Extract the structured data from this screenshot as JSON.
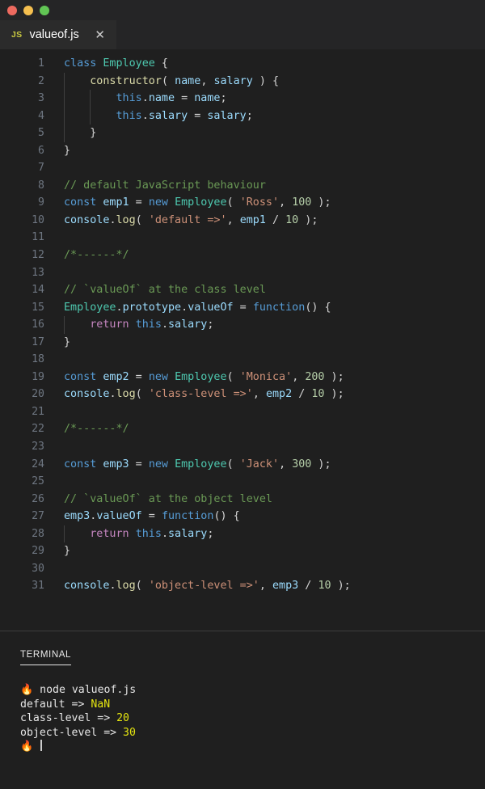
{
  "window": {
    "traffic_lights": [
      {
        "name": "close",
        "color": "#ed6a5f"
      },
      {
        "name": "minimize",
        "color": "#f5bf4f"
      },
      {
        "name": "maximize",
        "color": "#61c554"
      }
    ]
  },
  "tab": {
    "file_type_badge": "JS",
    "filename": "valueof.js",
    "close_glyph": "✕"
  },
  "editor": {
    "language": "javascript",
    "total_lines": 31,
    "lines": [
      {
        "n": "1",
        "indent": 0,
        "tokens": [
          {
            "t": "class",
            "c": "kw"
          },
          {
            "t": " ",
            "c": "pun"
          },
          {
            "t": "Employee",
            "c": "type"
          },
          {
            "t": " {",
            "c": "pun"
          }
        ]
      },
      {
        "n": "2",
        "indent": 1,
        "tokens": [
          {
            "t": "    ",
            "c": "pun"
          },
          {
            "t": "constructor",
            "c": "fn"
          },
          {
            "t": "( ",
            "c": "pun"
          },
          {
            "t": "name",
            "c": "var"
          },
          {
            "t": ", ",
            "c": "pun"
          },
          {
            "t": "salary",
            "c": "var"
          },
          {
            "t": " ) {",
            "c": "pun"
          }
        ]
      },
      {
        "n": "3",
        "indent": 2,
        "tokens": [
          {
            "t": "        ",
            "c": "pun"
          },
          {
            "t": "this",
            "c": "kw"
          },
          {
            "t": ".",
            "c": "pun"
          },
          {
            "t": "name",
            "c": "var"
          },
          {
            "t": " = ",
            "c": "pun"
          },
          {
            "t": "name",
            "c": "var"
          },
          {
            "t": ";",
            "c": "pun"
          }
        ]
      },
      {
        "n": "4",
        "indent": 2,
        "tokens": [
          {
            "t": "        ",
            "c": "pun"
          },
          {
            "t": "this",
            "c": "kw"
          },
          {
            "t": ".",
            "c": "pun"
          },
          {
            "t": "salary",
            "c": "var"
          },
          {
            "t": " = ",
            "c": "pun"
          },
          {
            "t": "salary",
            "c": "var"
          },
          {
            "t": ";",
            "c": "pun"
          }
        ]
      },
      {
        "n": "5",
        "indent": 1,
        "tokens": [
          {
            "t": "    }",
            "c": "pun"
          }
        ]
      },
      {
        "n": "6",
        "indent": 0,
        "tokens": [
          {
            "t": "}",
            "c": "pun"
          }
        ]
      },
      {
        "n": "7",
        "indent": 0,
        "tokens": []
      },
      {
        "n": "8",
        "indent": 0,
        "tokens": [
          {
            "t": "// default JavaScript behaviour",
            "c": "cmt"
          }
        ]
      },
      {
        "n": "9",
        "indent": 0,
        "tokens": [
          {
            "t": "const",
            "c": "kw"
          },
          {
            "t": " ",
            "c": "pun"
          },
          {
            "t": "emp1",
            "c": "var"
          },
          {
            "t": " = ",
            "c": "pun"
          },
          {
            "t": "new",
            "c": "kw"
          },
          {
            "t": " ",
            "c": "pun"
          },
          {
            "t": "Employee",
            "c": "type"
          },
          {
            "t": "( ",
            "c": "pun"
          },
          {
            "t": "'Ross'",
            "c": "str"
          },
          {
            "t": ", ",
            "c": "pun"
          },
          {
            "t": "100",
            "c": "num"
          },
          {
            "t": " );",
            "c": "pun"
          }
        ]
      },
      {
        "n": "10",
        "indent": 0,
        "tokens": [
          {
            "t": "console",
            "c": "var"
          },
          {
            "t": ".",
            "c": "pun"
          },
          {
            "t": "log",
            "c": "fn"
          },
          {
            "t": "( ",
            "c": "pun"
          },
          {
            "t": "'default =>'",
            "c": "str"
          },
          {
            "t": ", ",
            "c": "pun"
          },
          {
            "t": "emp1",
            "c": "var"
          },
          {
            "t": " / ",
            "c": "pun"
          },
          {
            "t": "10",
            "c": "num"
          },
          {
            "t": " );",
            "c": "pun"
          }
        ]
      },
      {
        "n": "11",
        "indent": 0,
        "tokens": []
      },
      {
        "n": "12",
        "indent": 0,
        "tokens": [
          {
            "t": "/*------*/",
            "c": "cmt"
          }
        ]
      },
      {
        "n": "13",
        "indent": 0,
        "tokens": []
      },
      {
        "n": "14",
        "indent": 0,
        "tokens": [
          {
            "t": "// `valueOf` at the class level",
            "c": "cmt"
          }
        ]
      },
      {
        "n": "15",
        "indent": 0,
        "tokens": [
          {
            "t": "Employee",
            "c": "type"
          },
          {
            "t": ".",
            "c": "pun"
          },
          {
            "t": "prototype",
            "c": "var"
          },
          {
            "t": ".",
            "c": "pun"
          },
          {
            "t": "valueOf",
            "c": "var"
          },
          {
            "t": " = ",
            "c": "pun"
          },
          {
            "t": "function",
            "c": "kw"
          },
          {
            "t": "() {",
            "c": "pun"
          }
        ]
      },
      {
        "n": "16",
        "indent": 1,
        "tokens": [
          {
            "t": "    ",
            "c": "pun"
          },
          {
            "t": "return",
            "c": "ctrl"
          },
          {
            "t": " ",
            "c": "pun"
          },
          {
            "t": "this",
            "c": "kw"
          },
          {
            "t": ".",
            "c": "pun"
          },
          {
            "t": "salary",
            "c": "var"
          },
          {
            "t": ";",
            "c": "pun"
          }
        ]
      },
      {
        "n": "17",
        "indent": 0,
        "tokens": [
          {
            "t": "}",
            "c": "pun"
          }
        ]
      },
      {
        "n": "18",
        "indent": 0,
        "tokens": []
      },
      {
        "n": "19",
        "indent": 0,
        "tokens": [
          {
            "t": "const",
            "c": "kw"
          },
          {
            "t": " ",
            "c": "pun"
          },
          {
            "t": "emp2",
            "c": "var"
          },
          {
            "t": " = ",
            "c": "pun"
          },
          {
            "t": "new",
            "c": "kw"
          },
          {
            "t": " ",
            "c": "pun"
          },
          {
            "t": "Employee",
            "c": "type"
          },
          {
            "t": "( ",
            "c": "pun"
          },
          {
            "t": "'Monica'",
            "c": "str"
          },
          {
            "t": ", ",
            "c": "pun"
          },
          {
            "t": "200",
            "c": "num"
          },
          {
            "t": " );",
            "c": "pun"
          }
        ]
      },
      {
        "n": "20",
        "indent": 0,
        "tokens": [
          {
            "t": "console",
            "c": "var"
          },
          {
            "t": ".",
            "c": "pun"
          },
          {
            "t": "log",
            "c": "fn"
          },
          {
            "t": "( ",
            "c": "pun"
          },
          {
            "t": "'class-level =>'",
            "c": "str"
          },
          {
            "t": ", ",
            "c": "pun"
          },
          {
            "t": "emp2",
            "c": "var"
          },
          {
            "t": " / ",
            "c": "pun"
          },
          {
            "t": "10",
            "c": "num"
          },
          {
            "t": " );",
            "c": "pun"
          }
        ]
      },
      {
        "n": "21",
        "indent": 0,
        "tokens": []
      },
      {
        "n": "22",
        "indent": 0,
        "tokens": [
          {
            "t": "/*------*/",
            "c": "cmt"
          }
        ]
      },
      {
        "n": "23",
        "indent": 0,
        "tokens": []
      },
      {
        "n": "24",
        "indent": 0,
        "tokens": [
          {
            "t": "const",
            "c": "kw"
          },
          {
            "t": " ",
            "c": "pun"
          },
          {
            "t": "emp3",
            "c": "var"
          },
          {
            "t": " = ",
            "c": "pun"
          },
          {
            "t": "new",
            "c": "kw"
          },
          {
            "t": " ",
            "c": "pun"
          },
          {
            "t": "Employee",
            "c": "type"
          },
          {
            "t": "( ",
            "c": "pun"
          },
          {
            "t": "'Jack'",
            "c": "str"
          },
          {
            "t": ", ",
            "c": "pun"
          },
          {
            "t": "300",
            "c": "num"
          },
          {
            "t": " );",
            "c": "pun"
          }
        ]
      },
      {
        "n": "25",
        "indent": 0,
        "tokens": []
      },
      {
        "n": "26",
        "indent": 0,
        "tokens": [
          {
            "t": "// `valueOf` at the object level",
            "c": "cmt"
          }
        ]
      },
      {
        "n": "27",
        "indent": 0,
        "tokens": [
          {
            "t": "emp3",
            "c": "var"
          },
          {
            "t": ".",
            "c": "pun"
          },
          {
            "t": "valueOf",
            "c": "var"
          },
          {
            "t": " = ",
            "c": "pun"
          },
          {
            "t": "function",
            "c": "kw"
          },
          {
            "t": "() {",
            "c": "pun"
          }
        ]
      },
      {
        "n": "28",
        "indent": 1,
        "tokens": [
          {
            "t": "    ",
            "c": "pun"
          },
          {
            "t": "return",
            "c": "ctrl"
          },
          {
            "t": " ",
            "c": "pun"
          },
          {
            "t": "this",
            "c": "kw"
          },
          {
            "t": ".",
            "c": "pun"
          },
          {
            "t": "salary",
            "c": "var"
          },
          {
            "t": ";",
            "c": "pun"
          }
        ]
      },
      {
        "n": "29",
        "indent": 0,
        "tokens": [
          {
            "t": "}",
            "c": "pun"
          }
        ]
      },
      {
        "n": "30",
        "indent": 0,
        "tokens": []
      },
      {
        "n": "31",
        "indent": 0,
        "tokens": [
          {
            "t": "console",
            "c": "var"
          },
          {
            "t": ".",
            "c": "pun"
          },
          {
            "t": "log",
            "c": "fn"
          },
          {
            "t": "( ",
            "c": "pun"
          },
          {
            "t": "'object-level =>'",
            "c": "str"
          },
          {
            "t": ", ",
            "c": "pun"
          },
          {
            "t": "emp3",
            "c": "var"
          },
          {
            "t": " / ",
            "c": "pun"
          },
          {
            "t": "10",
            "c": "num"
          },
          {
            "t": " );",
            "c": "pun"
          }
        ]
      }
    ]
  },
  "panel": {
    "active_tab": "TERMINAL",
    "terminal": {
      "lines": [
        {
          "parts": [
            {
              "t": "🔥",
              "c": "flame"
            },
            {
              "t": " node valueof.js",
              "c": "plain"
            }
          ]
        },
        {
          "parts": [
            {
              "t": "default => ",
              "c": "plain"
            },
            {
              "t": "NaN",
              "c": "tnum"
            }
          ]
        },
        {
          "parts": [
            {
              "t": "class-level => ",
              "c": "plain"
            },
            {
              "t": "20",
              "c": "tnum"
            }
          ]
        },
        {
          "parts": [
            {
              "t": "object-level => ",
              "c": "plain"
            },
            {
              "t": "30",
              "c": "tnum"
            }
          ]
        },
        {
          "parts": [
            {
              "t": "🔥",
              "c": "flame"
            },
            {
              "t": " ",
              "c": "plain"
            },
            {
              "t": "",
              "c": "cursor"
            }
          ]
        }
      ]
    }
  },
  "colors": {
    "editor_background": "#1f1f1f",
    "chrome_background": "#252526",
    "keyword": "#569cd6",
    "type": "#4ec9b0",
    "function": "#dcdcaa",
    "variable": "#9cdcfe",
    "string": "#ce9178",
    "number": "#b5cea8",
    "comment": "#6a9955",
    "control": "#c586c0",
    "terminal_number": "#e5e510",
    "line_number": "#6e7681"
  }
}
